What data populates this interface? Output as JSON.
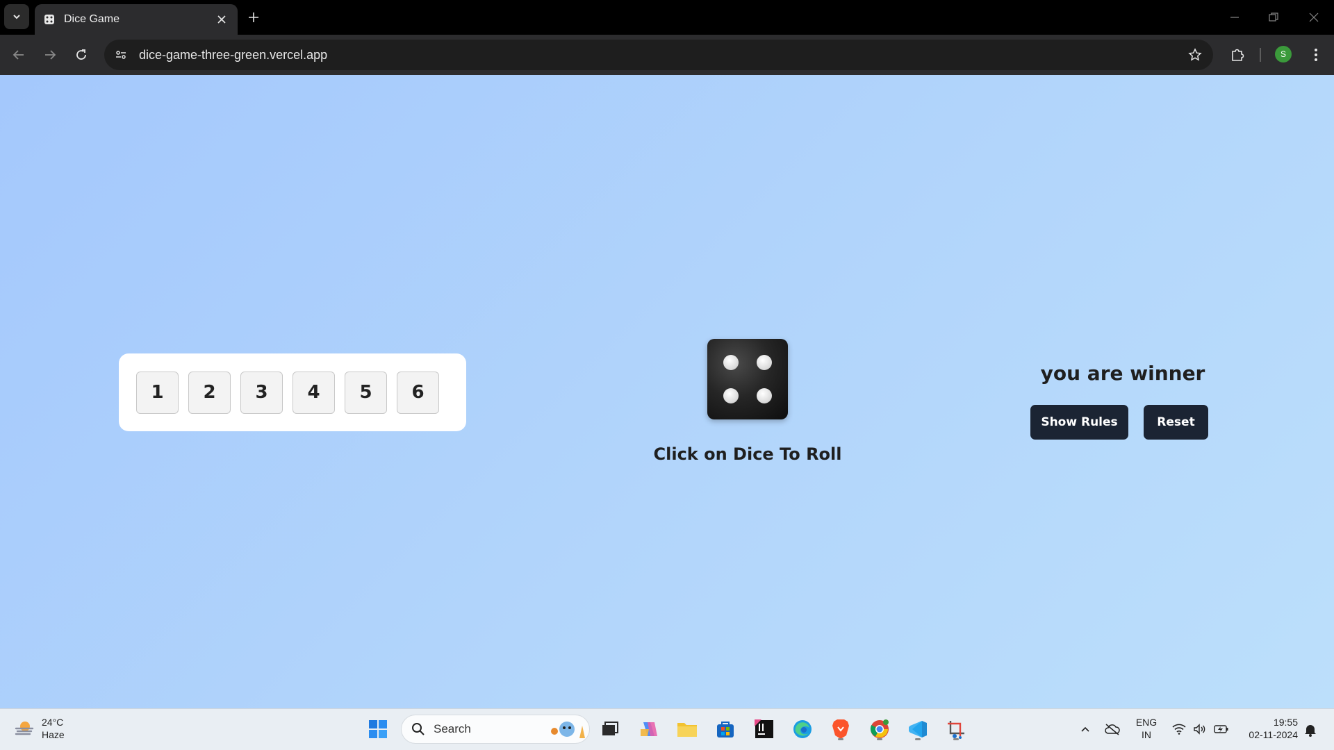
{
  "browser": {
    "tab_title": "Dice Game",
    "url": "dice-game-three-green.vercel.app",
    "profile_initial": "S"
  },
  "game": {
    "numbers": [
      "1",
      "2",
      "3",
      "4",
      "5",
      "6"
    ],
    "dice_face": 4,
    "roll_hint": "Click on Dice To Roll",
    "result_text": "you are winner",
    "show_rules_label": "Show Rules",
    "reset_label": "Reset"
  },
  "taskbar": {
    "weather_temp": "24°C",
    "weather_desc": "Haze",
    "search_placeholder": "Search",
    "lang_line1": "ENG",
    "lang_line2": "IN",
    "time": "19:55",
    "date": "02-11-2024"
  },
  "colors": {
    "page_bg": "#b2d5fb",
    "button_bg": "#1b2433",
    "dice": "#1a1a1a"
  }
}
